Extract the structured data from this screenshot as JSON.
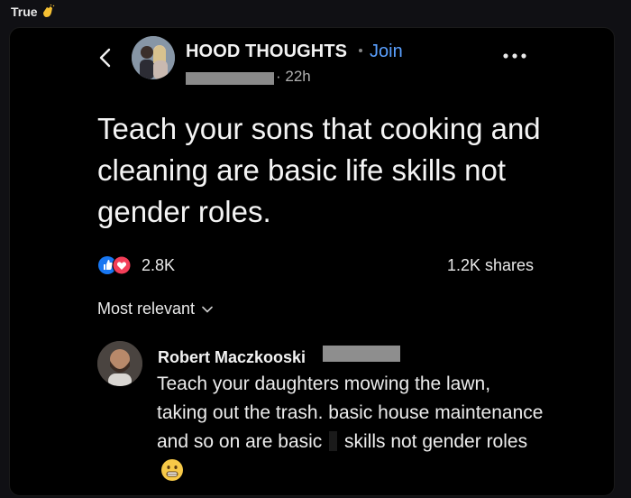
{
  "outer": {
    "label": "True"
  },
  "post": {
    "page_name": "HOOD THOUGHTS",
    "join_label": "Join",
    "time_label": "· 22h",
    "text": "Teach your sons that cooking and cleaning are basic life skills not gender roles.",
    "reaction_count": "2.8K",
    "shares_label": "1.2K shares"
  },
  "comments": {
    "sort_label": "Most relevant",
    "items": [
      {
        "author": "Robert Maczkooski",
        "text_part1": "Teach your daughters mowing the lawn, taking out the trash. basic house maintenance and so on are basic",
        "text_part2": "skills not gender roles"
      }
    ]
  },
  "colors": {
    "accent": "#5aa0ff",
    "like_blue": "#1877f2",
    "love_red": "#f33e58"
  },
  "icons": [
    "clapping-hands-icon",
    "back-chevron-icon",
    "more-dots-icon",
    "like-reaction-icon",
    "love-reaction-icon",
    "chevron-down-icon",
    "grimacing-face-emoji-icon"
  ]
}
